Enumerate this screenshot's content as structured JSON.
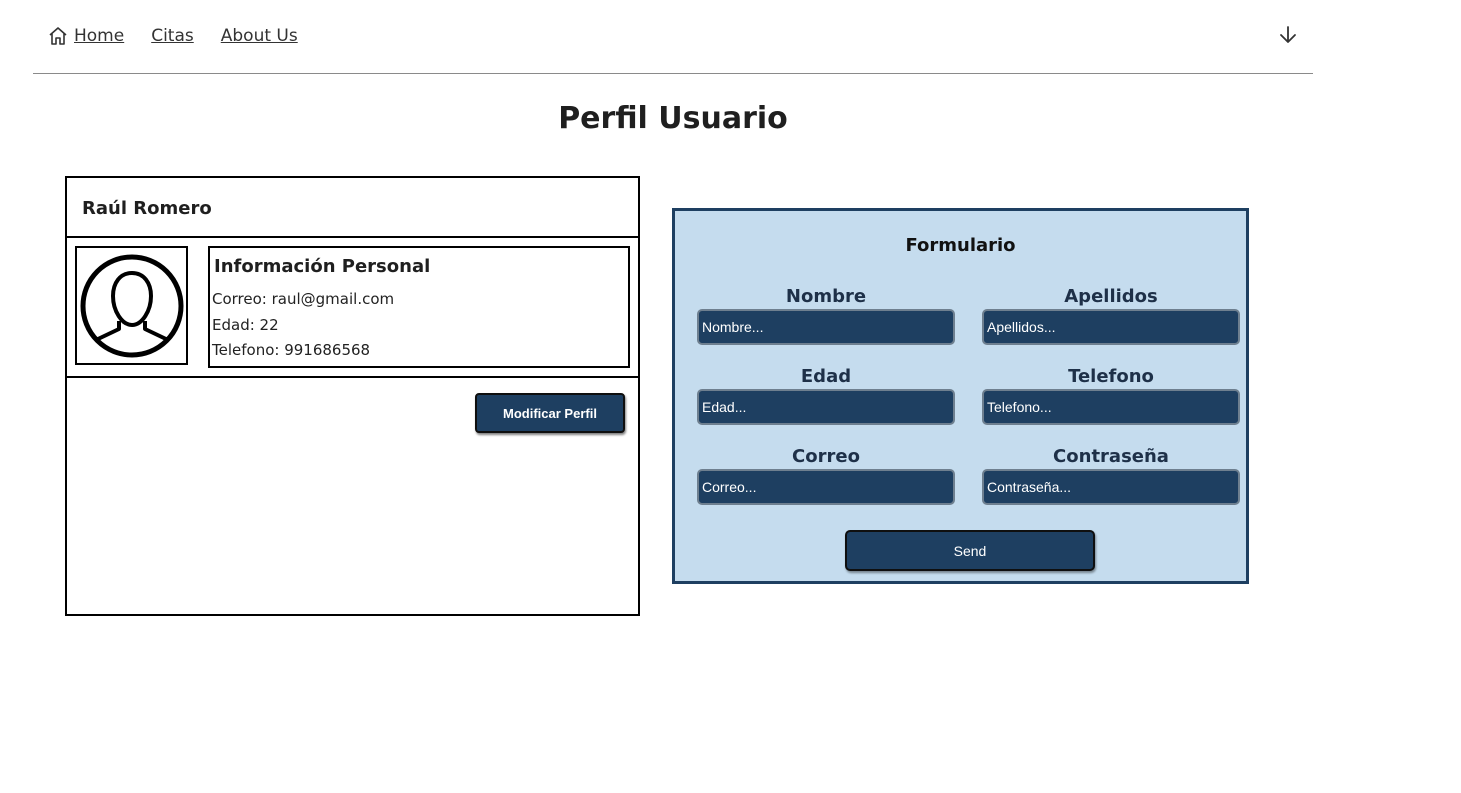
{
  "nav": {
    "home_label": "Home",
    "citas_label": "Citas",
    "about_label": "About Us",
    "home_icon": "home-icon",
    "menu_icon": "arrow-down-icon"
  },
  "page": {
    "title": "Perfil Usuario"
  },
  "profile": {
    "name": "Raúl Romero",
    "info_title": "Información Personal",
    "email_line": "Correo: raul@gmail.com",
    "age_line": "Edad: 22",
    "phone_line": "Telefono: 991686568",
    "avatar_icon": "user-avatar-icon",
    "modify_label": "Modificar Perfil"
  },
  "form": {
    "title": "Formulario",
    "fields": [
      {
        "label": "Nombre",
        "placeholder": "Nombre..."
      },
      {
        "label": "Apellidos",
        "placeholder": "Apellidos..."
      },
      {
        "label": "Edad",
        "placeholder": "Edad..."
      },
      {
        "label": "Telefono",
        "placeholder": "Telefono..."
      },
      {
        "label": "Correo",
        "placeholder": "Correo..."
      },
      {
        "label": "Contraseña",
        "placeholder": "Contraseña..."
      }
    ],
    "send_label": "Send"
  },
  "colors": {
    "primary": "#1e3f61",
    "form_background": "#c5dcee",
    "text": "#1f1f1f"
  }
}
